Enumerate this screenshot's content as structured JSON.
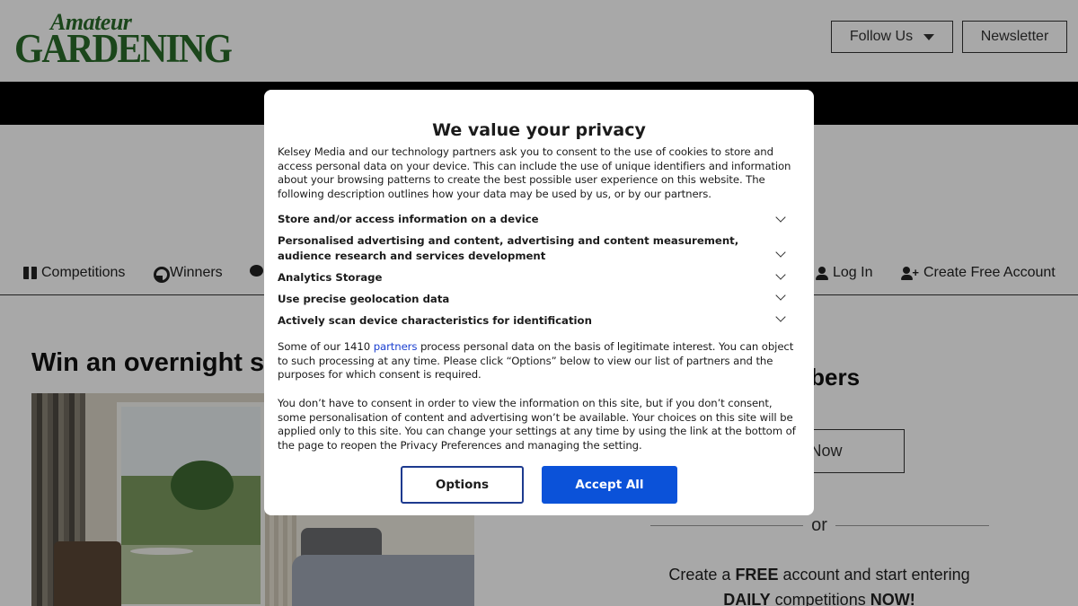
{
  "header": {
    "logo_line1": "Amateur",
    "logo_line2": "GARDENING",
    "follow_label": "Follow Us",
    "newsletter_label": "Newsletter"
  },
  "nav": {
    "competitions": "Competitions",
    "winners": "Winners",
    "login": "Log In",
    "create_account": "Create Free Account"
  },
  "main": {
    "headline": "Win an overnight st",
    "members_heading": "Members",
    "join_label": "n Now",
    "or_label": "or",
    "promo_pre": "Create a ",
    "promo_free": "FREE",
    "promo_mid": " account and start entering",
    "promo_daily": "DAILY",
    "promo_mid2": " competitions ",
    "promo_now": "NOW!"
  },
  "modal": {
    "title": "We value your privacy",
    "intro": "Kelsey Media and our technology partners ask you to consent to the use of cookies to store and access personal data on your device. This can include the use of unique identifiers and information about your browsing patterns to create the best possible user experience on this website. The following description outlines how your data may be used by us, or by our partners.",
    "purposes": [
      "Store and/or access information on a device",
      "Personalised advertising and content, advertising and content measurement, audience research and services development",
      "Analytics Storage",
      "Use precise geolocation data",
      "Actively scan device characteristics for identification"
    ],
    "legit_pre": "Some of our 1410 ",
    "legit_link": "partners",
    "legit_post": " process personal data on the basis of legitimate interest. You can object to such processing at any time. Please click “Options” below to view our list of partners and the purposes for which consent is required.",
    "no_consent": "You don’t have to consent in order to view the information on this site, but if you don’t consent, some personalisation of content and advertising won’t be available. Your choices on this site will be applied only to this site. You can change your settings at any time by using the link at the bottom of the page to reopen the Privacy Preferences and managing the setting.",
    "options_label": "Options",
    "accept_label": "Accept All"
  },
  "colors": {
    "brand_green": "#2a6b2a",
    "accept_blue": "#0b52d9",
    "link_blue": "#1a3fd0",
    "overlay": "rgba(0,0,0,0.34)"
  }
}
